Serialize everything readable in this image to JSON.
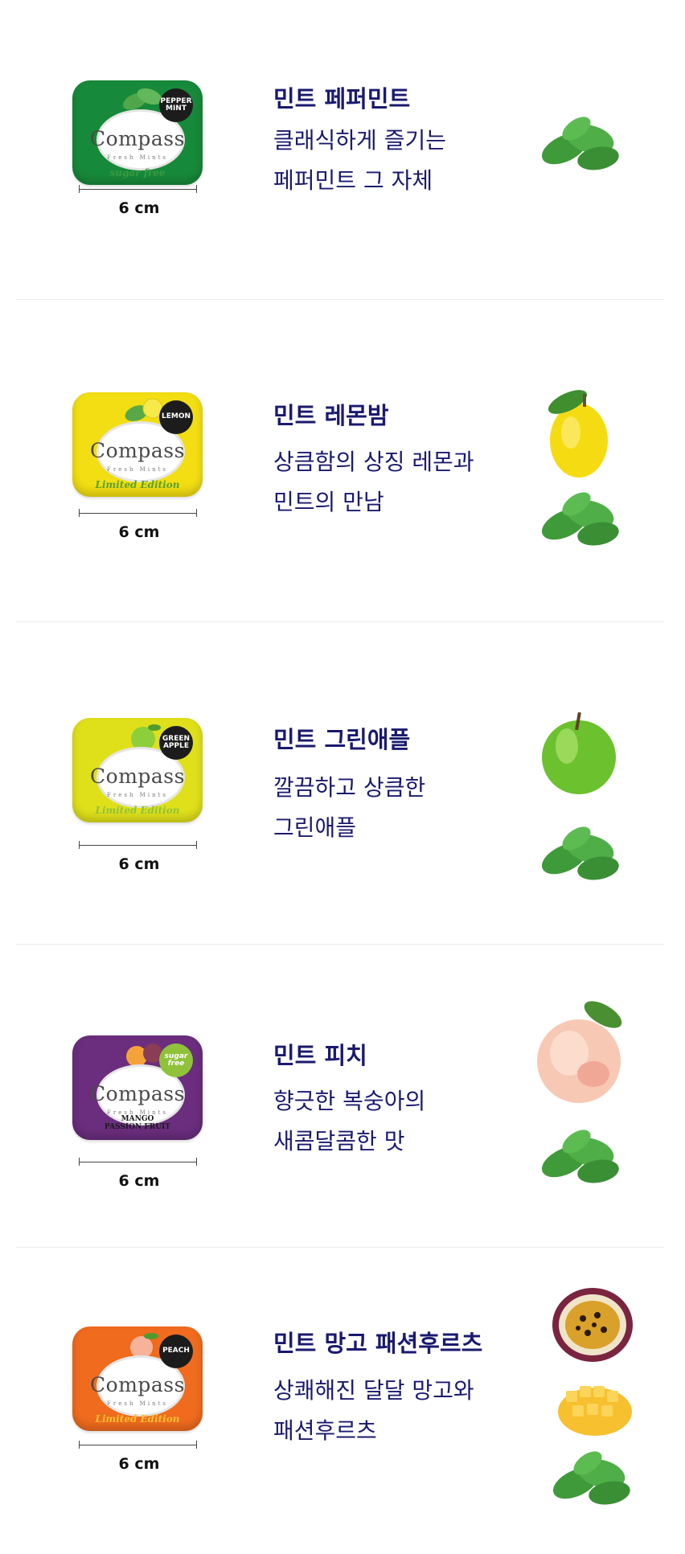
{
  "products": [
    {
      "title": "민트 페퍼민트",
      "desc_line1": "클래식하게 즐기는",
      "desc_line2": "페퍼민트 그 자체",
      "size": "6 cm",
      "tin": {
        "color": "#17893a",
        "brand": "Compass",
        "sub": "Fresh Mints",
        "script": "sugar free",
        "script_color": "#2e8b3a",
        "badge": "PEPPER\nMINT"
      },
      "fruits": [
        "mint-icon"
      ]
    },
    {
      "title": "민트 레몬밤",
      "desc_line1": "상큼함의 상징 레몬과",
      "desc_line2": "민트의 만남",
      "size": "6 cm",
      "tin": {
        "color": "#f2de12",
        "brand": "Compass",
        "sub": "Fresh Mints",
        "script": "Limited Edition",
        "script_color": "#5aa02c",
        "badge": "LEMON"
      },
      "fruits": [
        "lemon-icon",
        "mint-icon"
      ]
    },
    {
      "title": "민트 그린애플",
      "desc_line1": "깔끔하고 상큼한",
      "desc_line2": "그린애플",
      "size": "6 cm",
      "tin": {
        "color": "#dfe01a",
        "brand": "Compass",
        "sub": "Fresh Mints",
        "script": "Limited Edition",
        "script_color": "#7cb92e",
        "badge": "GREEN\nAPPLE"
      },
      "fruits": [
        "green-apple-icon",
        "mint-icon"
      ]
    },
    {
      "title": "민트 피치",
      "desc_line1": "향긋한 복숭아의",
      "desc_line2": "새콤달콤한 맛",
      "size": "6 cm",
      "tin": {
        "color": "#6b2d7e",
        "brand": "Compass",
        "sub": "Fresh Mints",
        "script": "MANGO\nPASSION FRUIT",
        "script_color": "#1a1a1a",
        "badge": "sugar\nfree"
      },
      "fruits": [
        "peach-icon",
        "mint-icon"
      ]
    },
    {
      "title": "민트 망고 패션후르츠",
      "desc_line1": "상쾌해진 달달 망고와",
      "desc_line2": "패션후르츠",
      "size": "6 cm",
      "tin": {
        "color": "#f06b1e",
        "brand": "Compass",
        "sub": "Fresh Mints",
        "script": "Limited Edition",
        "script_color": "#f7c030",
        "badge": "PEACH"
      },
      "fruits": [
        "passion-fruit-icon",
        "mango-icon",
        "mint-icon"
      ]
    }
  ]
}
